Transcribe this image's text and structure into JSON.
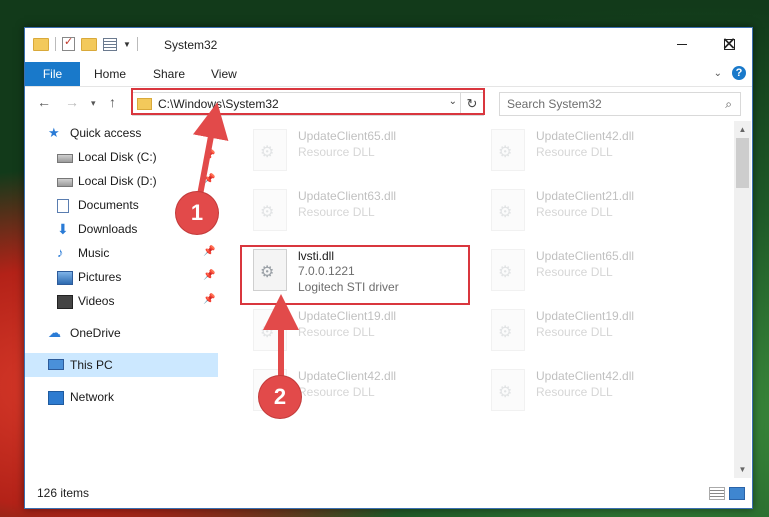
{
  "window": {
    "title": "System32",
    "controls": {
      "minimize": "minimize",
      "maximize": "maximize",
      "close": "close"
    }
  },
  "ribbon": {
    "file_tab": "File",
    "tabs": [
      "Home",
      "Share",
      "View"
    ]
  },
  "address": {
    "path": "C:\\Windows\\System32",
    "search_placeholder": "Search System32"
  },
  "nav_pane": {
    "items": [
      {
        "label": "Quick access",
        "icon": "star-icon",
        "pinned": false
      },
      {
        "label": "Local Disk (C:)",
        "icon": "drive-icon",
        "pinned": true
      },
      {
        "label": "Local Disk (D:)",
        "icon": "drive-icon",
        "pinned": true
      },
      {
        "label": "Documents",
        "icon": "documents-icon",
        "pinned": true
      },
      {
        "label": "Downloads",
        "icon": "download-icon",
        "pinned": true
      },
      {
        "label": "Music",
        "icon": "music-icon",
        "pinned": true
      },
      {
        "label": "Pictures",
        "icon": "pictures-icon",
        "pinned": true
      },
      {
        "label": "Videos",
        "icon": "videos-icon",
        "pinned": true
      },
      {
        "label": "OneDrive",
        "icon": "cloud-icon",
        "pinned": false
      },
      {
        "label": "This PC",
        "icon": "computer-icon",
        "pinned": false,
        "selected": true
      },
      {
        "label": "Network",
        "icon": "network-icon",
        "pinned": false
      }
    ]
  },
  "files": {
    "background_tiles": [
      {
        "name": "UpdateClient65.dll",
        "type": "Resource DLL"
      },
      {
        "name": "UpdateClient42.dll",
        "type": "Resource DLL"
      },
      {
        "name": "UpdateClient63.dll",
        "type": "Resource DLL"
      },
      {
        "name": "UpdateClient21.dll",
        "type": "Resource DLL"
      },
      {
        "name": "UpdateClient65.dll",
        "type": "Resource DLL"
      },
      {
        "name": "UpdateClient19.dll",
        "type": "Resource DLL"
      },
      {
        "name": "UpdateClient19.dll",
        "type": "Resource DLL"
      },
      {
        "name": "UpdateClient42.dll",
        "type": "Resource DLL"
      },
      {
        "name": "UpdateClient42.dll",
        "type": "Resource DLL"
      }
    ],
    "highlighted": {
      "name": "lvsti.dll",
      "version": "7.0.0.1221",
      "description": "Logitech STI driver"
    }
  },
  "status": {
    "item_count": "126 items"
  },
  "annotations": {
    "step1": "1",
    "step2": "2",
    "color": "#e24a4a"
  }
}
